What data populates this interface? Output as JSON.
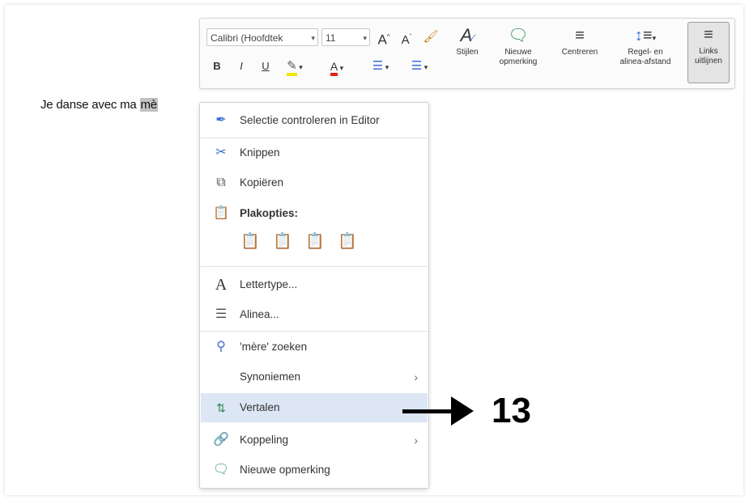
{
  "document": {
    "text_before": "Je danse avec ma ",
    "selected_text": "mè"
  },
  "toolbar": {
    "font_name": "Calibri (Hoofdtek",
    "font_size": "11",
    "grow_font_icon": "A^",
    "shrink_font_icon": "A˅",
    "format_painter_icon": "paintbrush",
    "styles_label": "Stijlen",
    "new_comment_label": [
      "Nieuwe",
      "opmerking"
    ],
    "center_label": "Centreren",
    "line_spacing_label": [
      "Regel- en",
      "alinea-afstand"
    ],
    "align_left_label": [
      "Links",
      "uitlijnen"
    ],
    "bold": "B",
    "italic": "I",
    "underline": "U",
    "font_color": "A"
  },
  "context_menu": {
    "items": [
      {
        "icon": "pen-icon",
        "label": "Selectie controleren in Editor"
      },
      {
        "icon": "scissors-icon",
        "label": "Knippen"
      },
      {
        "icon": "copy-icon",
        "label": "Kopiëren"
      },
      {
        "icon": "clipboard-icon",
        "label": "Plakopties:"
      },
      {
        "icon": "font-icon",
        "label": "Lettertype..."
      },
      {
        "icon": "paragraph-icon",
        "label": "Alinea..."
      },
      {
        "icon": "search-icon",
        "label": "'mère' zoeken"
      },
      {
        "icon": "",
        "label": "Synoniemen"
      },
      {
        "icon": "translate-icon",
        "label": "Vertalen"
      },
      {
        "icon": "link-icon",
        "label": "Koppeling"
      },
      {
        "icon": "comment-icon",
        "label": "Nieuwe opmerking"
      }
    ],
    "highlighted": "Vertalen"
  },
  "annotation": {
    "step_number": "13"
  },
  "colors": {
    "highlight": "#dce6f4",
    "selection": "#c2c2c2",
    "paste_icon": "#d58a1f",
    "editor_pen": "#3b6fd4"
  }
}
